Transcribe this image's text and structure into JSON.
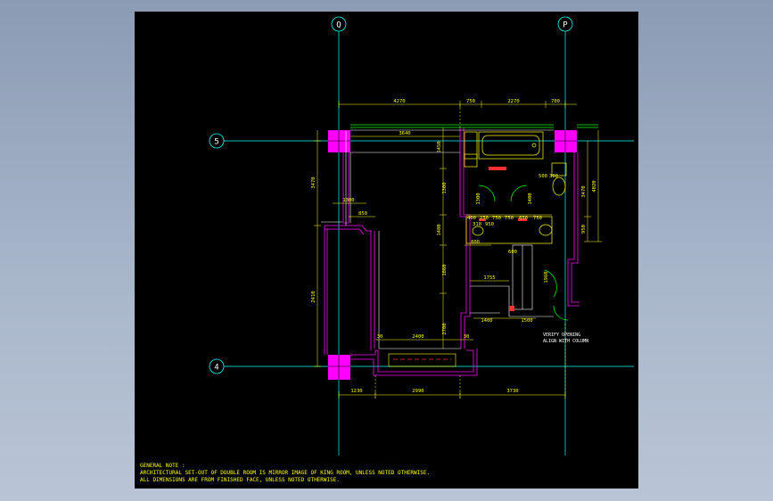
{
  "grid": {
    "columns": [
      "Q",
      "P"
    ],
    "rows": [
      "5",
      "4"
    ]
  },
  "dimensions": {
    "top": [
      "4270",
      "750",
      "2270",
      "700"
    ],
    "room_width": "3640",
    "left_upper": "3470",
    "left_lower": "2410",
    "right_outer": [
      "3470",
      "4020"
    ],
    "right_inner": "950",
    "corridor": [
      "1300",
      "850"
    ],
    "bath_vertical": [
      "1450",
      "1300",
      "1480",
      "1860",
      "2700"
    ],
    "vanity": [
      "400",
      "250",
      "750",
      "750",
      "850",
      "750"
    ],
    "vanity_sub": [
      "800",
      "600"
    ],
    "lower_room": [
      "30",
      "2400",
      "30"
    ],
    "entry": [
      "1755",
      "1400",
      "1500"
    ],
    "closet": "1960",
    "bottom": [
      "1230",
      "2990",
      "3730"
    ],
    "small": [
      "500",
      "300",
      "950",
      "310",
      "1300",
      "1400"
    ]
  },
  "annotation": [
    "VERIFY OPENING",
    "ALIGN WITH COLUMN"
  ],
  "notes": {
    "heading": "GENERAL NOTE :",
    "lines": [
      "ARCHITECTURAL SET-OUT OF DOUBLE ROOM IS MIRROR IMAGE OF KING ROOM, UNLESS NOTED OTHERWISE.",
      "ALL DIMENSIONS ARE FROM FINISHED FACE, UNLESS NOTED OTHERWISE."
    ]
  },
  "colors": {
    "background": "#000000",
    "grid_line": "#00ffff",
    "dimension": "#ffff00",
    "wall": "#ff00ff",
    "column": "#ff00ff",
    "outline": "#ffffff",
    "fixture": "#ffff00",
    "accent_red": "#ff3030",
    "accent_green": "#00ff00"
  }
}
